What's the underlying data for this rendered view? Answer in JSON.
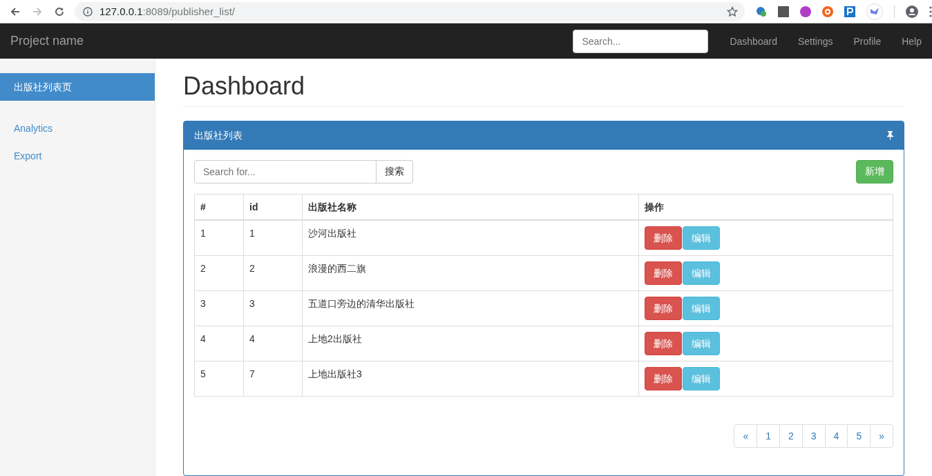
{
  "browser": {
    "url_host": "127.0.0.1",
    "url_path": ":8089/publisher_list/"
  },
  "navbar": {
    "brand": "Project name",
    "search": {
      "placeholder": "Search..."
    },
    "links": [
      "Dashboard",
      "Settings",
      "Profile",
      "Help"
    ]
  },
  "sidebar": {
    "groups": [
      [
        {
          "label": "出版社列表页",
          "selected": true
        }
      ],
      [
        {
          "label": "Analytics",
          "selected": false
        },
        {
          "label": "Export",
          "selected": false
        }
      ]
    ]
  },
  "page_title": "Dashboard",
  "panel": {
    "title": "出版社列表",
    "search": {
      "placeholder": "Search for...",
      "button": "搜索"
    },
    "add_button": "新增",
    "table": {
      "columns": [
        "#",
        "id",
        "出版社名称",
        "操作"
      ],
      "rows": [
        {
          "cells": [
            "1",
            "1",
            "沙河出版社"
          ],
          "actions": [
            "删除",
            "编辑"
          ]
        },
        {
          "cells": [
            "2",
            "2",
            "浪漫的西二旗"
          ],
          "actions": [
            "删除",
            "编辑"
          ]
        },
        {
          "cells": [
            "3",
            "3",
            "五道口旁边的清华出版社"
          ],
          "actions": [
            "删除",
            "编辑"
          ]
        },
        {
          "cells": [
            "4",
            "4",
            "上地2出版社"
          ],
          "actions": [
            "删除",
            "编辑"
          ]
        },
        {
          "cells": [
            "5",
            "7",
            "上地出版社3"
          ],
          "actions": [
            "删除",
            "编辑"
          ]
        }
      ]
    },
    "pagination": [
      "«",
      "1",
      "2",
      "3",
      "4",
      "5",
      "»"
    ]
  }
}
